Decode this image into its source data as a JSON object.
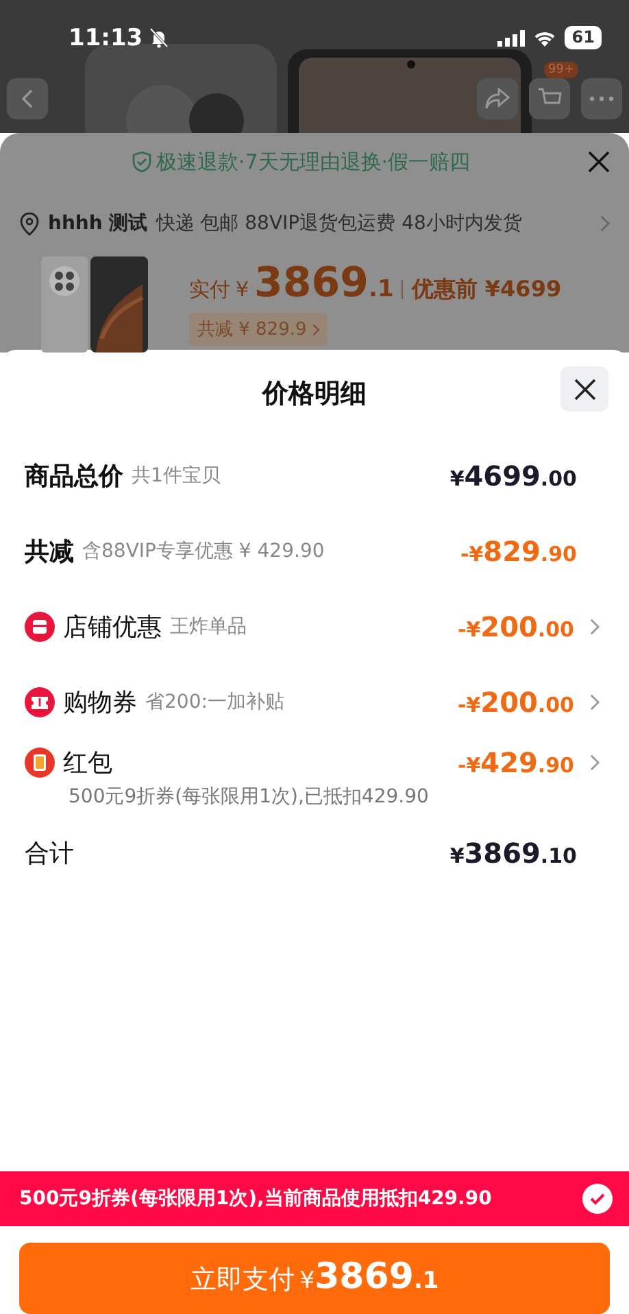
{
  "status_bar": {
    "time": "11:13",
    "battery": "61"
  },
  "nav": {
    "cart_badge": "99+"
  },
  "backdrop": {
    "guarantee": "极速退款·7天无理由退换·假一赔四",
    "address": {
      "name": "hhhh 测试",
      "shipping": "快递 包邮 88VIP退货包运费 48小时内发货"
    },
    "price": {
      "label": "实付",
      "currency": "¥",
      "main": "3869",
      "decimal": ".1",
      "before": "优惠前 ¥4699"
    },
    "discount_tag": "共减 ¥ 829.9"
  },
  "sheet": {
    "title": "价格明细",
    "rows": [
      {
        "kind": "subtotal",
        "label": "商品总价",
        "note": "共1件宝贝",
        "amount": {
          "currency": "¥",
          "main": "4699",
          "decimal": ".00"
        }
      },
      {
        "kind": "savings",
        "label": "共减",
        "note": "含88VIP专享优惠 ¥ 429.90",
        "amount": {
          "sign": "-",
          "currency": "¥",
          "main": "829",
          "decimal": ".90"
        }
      },
      {
        "kind": "store",
        "label": "店铺优惠",
        "note": "王炸单品",
        "amount": {
          "sign": "-",
          "currency": "¥",
          "main": "200",
          "decimal": ".00"
        }
      },
      {
        "kind": "ticket",
        "label": "购物券",
        "note": "省200:一加补贴",
        "amount": {
          "sign": "-",
          "currency": "¥",
          "main": "200",
          "decimal": ".00"
        }
      },
      {
        "kind": "envelope",
        "label": "红包",
        "amount": {
          "sign": "-",
          "currency": "¥",
          "main": "429",
          "decimal": ".90"
        },
        "detail": "500元9折券(每张限用1次),已抵扣429.90"
      },
      {
        "kind": "total",
        "label": "合计",
        "amount": {
          "currency": "¥",
          "main": "3869",
          "decimal": ".10"
        }
      }
    ]
  },
  "coupon_banner": {
    "text": "500元9折券(每张限用1次),当前商品使用抵扣429.90",
    "checked": true
  },
  "pay_button": {
    "label": "立即支付",
    "currency": "¥",
    "main": "3869",
    "decimal": ".1"
  }
}
